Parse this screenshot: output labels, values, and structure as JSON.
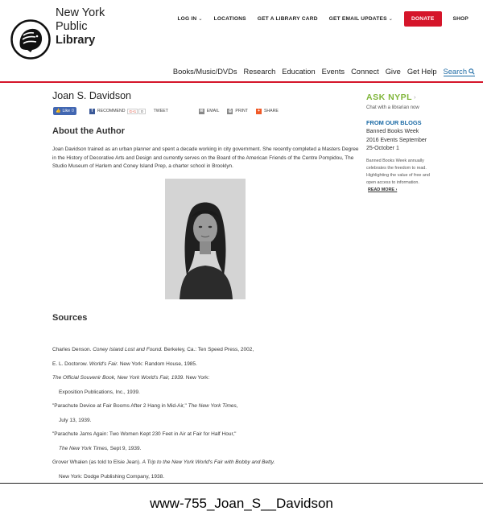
{
  "header": {
    "logo_lines": [
      "New York",
      "Public",
      "Library"
    ],
    "utility": {
      "login": "LOG IN",
      "locations": "LOCATIONS",
      "library_card": "GET A LIBRARY CARD",
      "email_updates": "GET EMAIL UPDATES",
      "donate": "DONATE",
      "shop": "SHOP"
    },
    "nav": [
      "Books/Music/DVDs",
      "Research",
      "Education",
      "Events",
      "Connect",
      "Give",
      "Get Help"
    ],
    "search_label": "Search",
    "accent_red": "#d5152a",
    "link_blue": "#1b6aa5"
  },
  "main": {
    "title": "Joan S. Davidson",
    "share": {
      "like": "Like",
      "like_count": "0",
      "recommend": "RECOMMEND",
      "gplus": "G+1",
      "gplus_count": "0",
      "tweet": "TWEET",
      "email": "EMAIL",
      "print": "PRINT",
      "share": "SHARE"
    },
    "about_heading": "About the Author",
    "about_text": "Joan Davidson trained as an urban planner and spent a decade working in city government. She recently completed a Masters Degree in the History of Decorative Arts and Design and currently serves on the Board of the American Friends of the Centre Pompidou, The Studio Museum of Harlem and Coney Island Prep, a charter school in Brooklyn.",
    "sources_heading": "Sources",
    "sources": [
      {
        "pre": "Charles Denson. ",
        "em": "Coney Island Lost and Found.",
        "post": " Berkeley, Ca.: Ten Speed Press, 2002,"
      },
      {
        "pre": "E. L. Doctorow. ",
        "em": "World's Fair.",
        "post": " New York: Random House, 1985."
      },
      {
        "pre": "",
        "em": "The Official Souvenir Book, New York World's Fair, 1939.",
        "post": " New York:"
      },
      {
        "pre": "Exposition Publications, Inc., 1939.",
        "em": "",
        "post": ""
      },
      {
        "pre": "\"Parachute Device at Fair Booms After 2 Hang in Mid-Air,\" ",
        "em": "The New York Times,",
        "post": ""
      },
      {
        "pre": "July 13, 1939.",
        "em": "",
        "post": ""
      },
      {
        "pre": "\"Parachute Jams Again: Two Women Kept 230 Feet in Air at Fair for Half Hour,\"",
        "em": "",
        "post": ""
      },
      {
        "pre": "",
        "em": "The New York Times,",
        "post": " Sept 9, 1939."
      },
      {
        "pre": "Grover Whalen (as told to Elsie Jean). ",
        "em": "A Trip to the New York World's Fair with Bobby and Betty.",
        "post": ""
      },
      {
        "pre": "New York: Dodge Publishing Company, 1938.",
        "em": "",
        "post": ""
      }
    ]
  },
  "sidebar": {
    "ask_logo": "ASK NYPL",
    "ask_subtitle": "Chat with a librarian now",
    "blogs_heading": "FROM OUR BLOGS",
    "blog_title": "Banned Books Week 2016 Events September 25-October 1",
    "blog_desc": "Banned Books Week annually celebrates the freedom to read. Highlighting the value of free and open access to information.",
    "read_more": "READ MORE ›",
    "ask_green": "#7fb539"
  },
  "caption": "www-755_Joan_S__Davidson"
}
